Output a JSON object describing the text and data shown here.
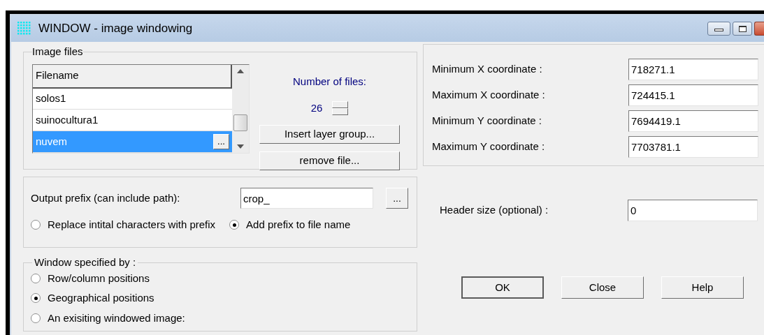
{
  "window": {
    "title": "WINDOW - image windowing"
  },
  "image_files": {
    "label": "Image files",
    "list": {
      "header": "Filename",
      "rows": [
        {
          "name": "solos1",
          "selected": false
        },
        {
          "name": "suinocultura1",
          "selected": false
        },
        {
          "name": "nuvem",
          "selected": true,
          "browse": "..."
        }
      ]
    },
    "count_label": "Number of files:",
    "count": "26",
    "buttons": [
      "Insert layer group...",
      "remove file..."
    ]
  },
  "output": {
    "label": "Output prefix (can include path):",
    "value": "crop_",
    "browse": "...",
    "options": [
      {
        "label": "Replace intital characters with prefix",
        "selected": false
      },
      {
        "label": "Add prefix to file name",
        "selected": true
      }
    ]
  },
  "window_spec": {
    "label": "Window specified by :",
    "options": [
      {
        "label": "Row/column positions",
        "selected": false
      },
      {
        "label": "Geographical positions",
        "selected": true
      },
      {
        "label": "An exisiting windowed image:",
        "selected": false
      }
    ]
  },
  "coordinates": [
    {
      "label": "Minimum X coordinate :",
      "value": "718271.1"
    },
    {
      "label": "Maximum X coordinate :",
      "value": "724415.1"
    },
    {
      "label": "Minimum Y coordinate :",
      "value": "7694419.1"
    },
    {
      "label": "Maximum Y coordinate :",
      "value": "7703781.1"
    }
  ],
  "header_size": {
    "label": "Header size (optional) :",
    "value": "0"
  },
  "buttons": [
    {
      "label": "OK",
      "default": true
    },
    {
      "label": "Close",
      "default": false
    },
    {
      "label": "Help",
      "default": false
    }
  ]
}
